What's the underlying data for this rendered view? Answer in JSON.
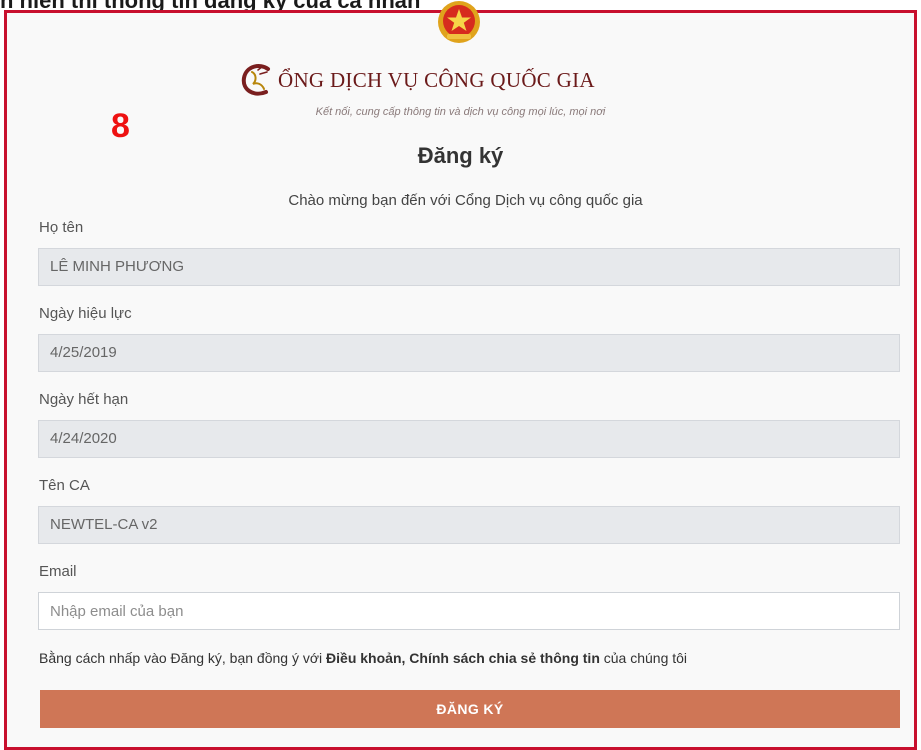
{
  "caption": "n hiển thị thông tin đăng ký của cá nhân",
  "step_number": "8",
  "header": {
    "portal_name": "ỔNG DỊCH VỤ CÔNG QUỐC GIA",
    "tagline": "Kết nối, cung cấp thông tin và dịch vụ công mọi lúc, mọi nơi",
    "logo_icon": "national-public-service-portal-logo",
    "emblem_icon": "national-emblem"
  },
  "form": {
    "title": "Đăng ký",
    "welcome": "Chào mừng bạn đến với Cổng Dịch vụ công quốc gia",
    "fields": {
      "full_name": {
        "label": "Họ tên",
        "value": "LÊ MINH PHƯƠNG"
      },
      "valid_from": {
        "label": "Ngày hiệu lực",
        "value": "4/25/2019"
      },
      "valid_to": {
        "label": "Ngày hết hạn",
        "value": "4/24/2020"
      },
      "ca_name": {
        "label": "Tên CA",
        "value": "NEWTEL-CA v2"
      },
      "email": {
        "label": "Email",
        "value": "",
        "placeholder": "Nhập email của bạn"
      }
    },
    "consent": {
      "prefix": "Bằng cách nhấp vào Đăng ký, bạn đồng ý với ",
      "terms": "Điều khoản",
      "separator": ", ",
      "policy": "Chính sách chia sẻ thông tin",
      "suffix": " của chúng tôi"
    },
    "submit_label": "ĐĂNG KÝ"
  },
  "colors": {
    "frame_border": "#c8102e",
    "button": "#cf7656",
    "step_number": "#ee1111",
    "brand": "#6b1a1a"
  }
}
